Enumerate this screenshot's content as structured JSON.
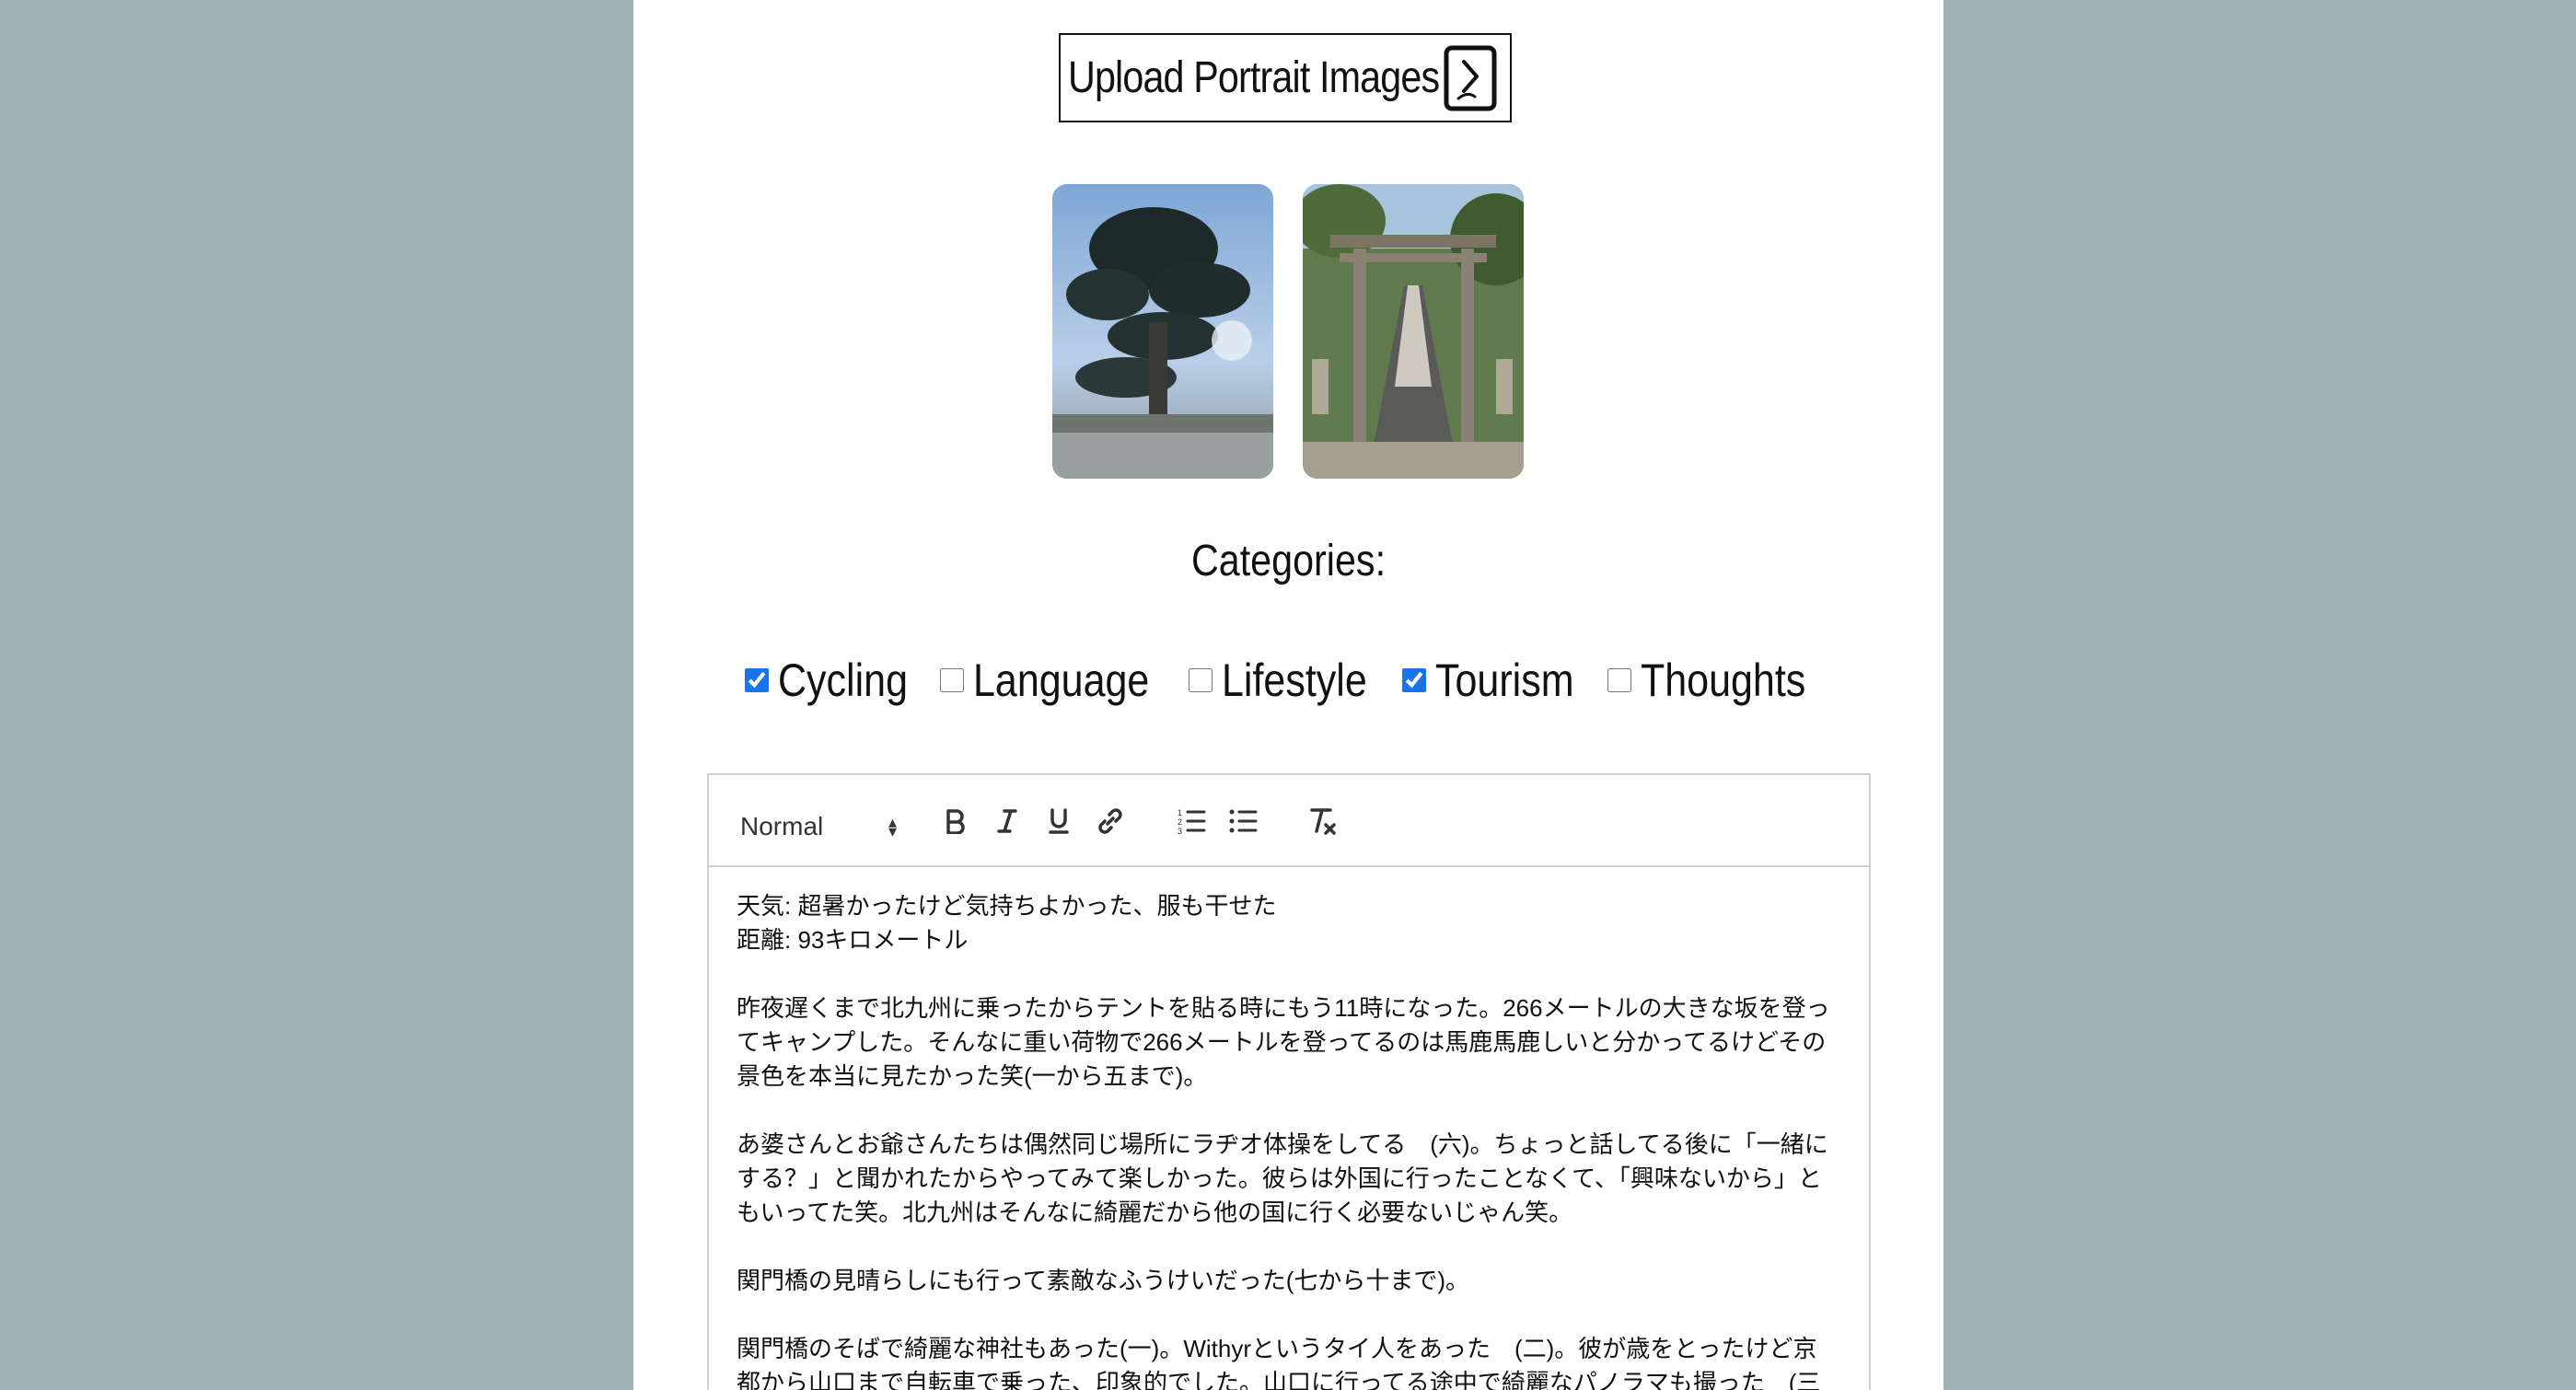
{
  "upload": {
    "label": "Upload Portrait Images",
    "icon": "phone-upload-icon"
  },
  "thumbnails": [
    {
      "name": "tree-photo",
      "description_icon": "image"
    },
    {
      "name": "shrine-gate-photo",
      "description_icon": "image"
    }
  ],
  "categories": {
    "title": "Categories:",
    "items": [
      {
        "label": "Cycling",
        "checked": true
      },
      {
        "label": "Language",
        "checked": false
      },
      {
        "label": "Lifestyle",
        "checked": false
      },
      {
        "label": "Tourism",
        "checked": true
      },
      {
        "label": "Thoughts",
        "checked": false
      }
    ]
  },
  "editor": {
    "format_value": "Normal",
    "toolbar_icons": [
      "bold-icon",
      "italic-icon",
      "underline-icon",
      "link-icon",
      "ordered-list-icon",
      "bullet-list-icon",
      "clear-format-icon"
    ],
    "paragraphs": [
      [
        "天気: 超暑かったけど気持ちよかった、服も干せた",
        "距離: 93キロメートル"
      ],
      [
        "昨夜遅くまで北九州に乗ったからテントを貼る時にもう11時になった。266メートルの大きな坂を登っ",
        "てキャンプした。そんなに重い荷物で266メートルを登ってるのは馬鹿馬鹿しいと分かってるけどその",
        "景色を本当に見たかった笑(一から五まで)。"
      ],
      [
        "あ婆さんとお爺さんたちは偶然同じ場所にラヂオ体操をしてる　(六)。ちょっと話してる後に「一緒に",
        "する？」と聞かれたからやってみて楽しかった。彼らは外国に行ったことなくて、「興味ないから」と",
        "もいってた笑。北九州はそんなに綺麗だから他の国に行く必要ないじゃん笑。"
      ],
      [
        "関門橋の見晴らしにも行って素敵なふうけいだった(七から十まで)。"
      ],
      [
        "関門橋のそばで綺麗な神社もあった(一)。Withyrというタイ人をあった　(二)。彼が歳をとったけど京",
        "都から山口まで自転車で乗った、印象的でした。山口に行ってる途中で綺麗なパノラマも撮った　(三"
      ]
    ]
  }
}
